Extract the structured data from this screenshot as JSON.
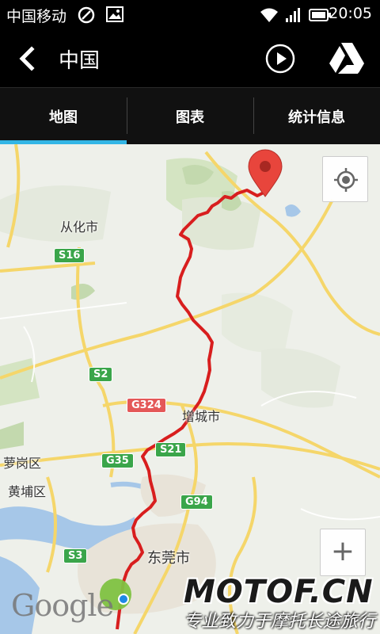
{
  "status_bar": {
    "carrier": "中国移动",
    "time": "20:05"
  },
  "action_bar": {
    "title": "中国",
    "icons": [
      "back-arrow-icon",
      "play-icon",
      "google-drive-icon"
    ]
  },
  "tabs": [
    {
      "label": "地图",
      "active": true
    },
    {
      "label": "图表",
      "active": false
    },
    {
      "label": "统计信息",
      "active": false
    }
  ],
  "map": {
    "places": [
      "从化市",
      "增城市",
      "萝岗区",
      "黄埔区",
      "东莞市"
    ],
    "road_shields": [
      "S16",
      "S2",
      "G324",
      "S21",
      "G35",
      "G94",
      "S3"
    ],
    "zoom_in_label": "+",
    "attribution": "Google",
    "route_color": "#d81e1e",
    "marker_color": "#e8453c"
  },
  "watermark": {
    "title": "MOTOF.CN",
    "subtitle": "专业致力于摩托长途旅行"
  }
}
